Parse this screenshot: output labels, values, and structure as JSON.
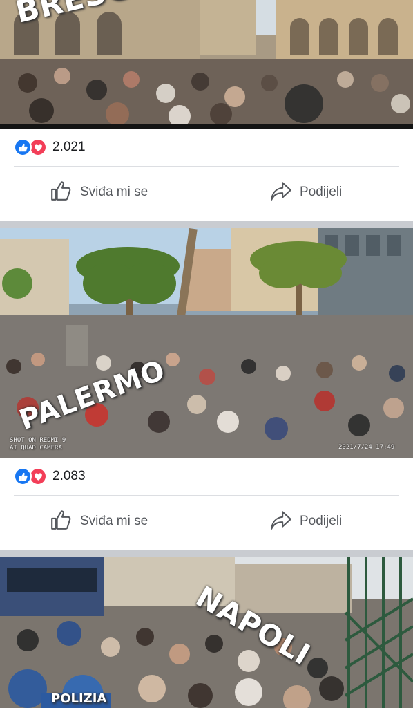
{
  "posts": [
    {
      "overlay": "BRESCI",
      "reaction_count": "2.021",
      "like_label": "Sviđa mi se",
      "share_label": "Podijeli",
      "caption_left": "",
      "caption_right": ""
    },
    {
      "overlay": "PALERMO",
      "reaction_count": "2.083",
      "like_label": "Sviđa mi se",
      "share_label": "Podijeli",
      "caption_left": "SHOT ON REDMI 9\nAI QUAD CAMERA",
      "caption_left_1": "SHOT ON REDMI 9",
      "caption_left_2": "AI QUAD CAMERA",
      "caption_right": "2021/7/24  17:49"
    },
    {
      "overlay": "NAPOLI",
      "vehicle_text": "POLIZIA"
    }
  ],
  "colors": {
    "like_blue": "#1877f2",
    "love_red": "#f33e58",
    "separator": "#c9ccd1"
  },
  "icons": [
    "thumbs-up-icon",
    "heart-icon",
    "like-outline-icon",
    "share-arrow-icon"
  ]
}
